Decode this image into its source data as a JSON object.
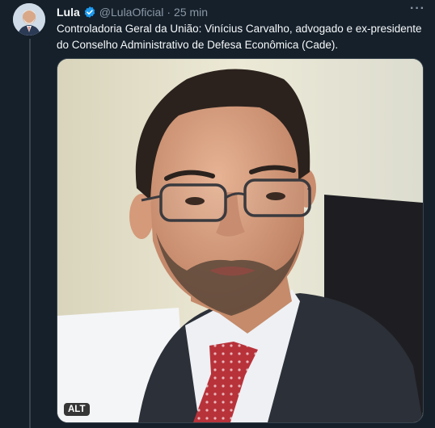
{
  "tweet": {
    "author_name": "Lula",
    "handle": "@LulaOficial",
    "separator": "·",
    "time": "25 min",
    "more_label": "···",
    "text": "Controladoria Geral da União: Vinícius Carvalho, advogado e ex-presidente do Conselho Administrativo de Defesa Econômica (Cade).",
    "verified_icon": "verified-badge-icon",
    "verified_color": "#1d9bf0"
  },
  "media": {
    "alt_badge": "ALT"
  },
  "colors": {
    "background": "#15202b",
    "secondary_text": "#8b98a5",
    "border": "#38444d"
  }
}
